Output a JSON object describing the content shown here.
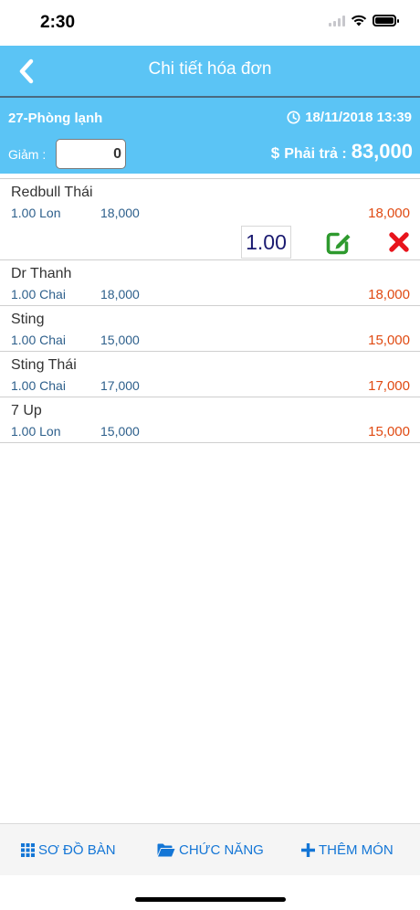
{
  "status": {
    "time": "2:30"
  },
  "header": {
    "title": "Chi tiết hóa đơn"
  },
  "info": {
    "room": "27-Phòng lạnh",
    "datetime": "18/11/2018 13:39",
    "discount_label": "Giảm :",
    "discount_value": "0",
    "currency": "$",
    "total_label": "Phải trả :",
    "total_value": "83,000"
  },
  "items": [
    {
      "name": "Redbull Thái",
      "qty": "1.00 Lon",
      "price": "18,000",
      "total": "18,000",
      "edit_qty": "1.00"
    },
    {
      "name": "Dr Thanh",
      "qty": "1.00 Chai",
      "price": "18,000",
      "total": "18,000"
    },
    {
      "name": "Sting",
      "qty": "1.00 Chai",
      "price": "15,000",
      "total": "15,000"
    },
    {
      "name": "Sting Thái",
      "qty": "1.00 Chai",
      "price": "17,000",
      "total": "17,000"
    },
    {
      "name": "7 Up",
      "qty": "1.00 Lon",
      "price": "15,000",
      "total": "15,000"
    }
  ],
  "tabs": [
    {
      "label": "SƠ ĐỒ BÀN",
      "icon": "grid-icon"
    },
    {
      "label": "CHỨC NĂNG",
      "icon": "folder-icon"
    },
    {
      "label": "THÊM MÓN",
      "icon": "plus-icon"
    }
  ],
  "colors": {
    "accent": "#5bc4f5",
    "link": "#1476d6",
    "amount": "#e04a12",
    "edit": "#2e9a2e",
    "delete": "#e8141c"
  }
}
